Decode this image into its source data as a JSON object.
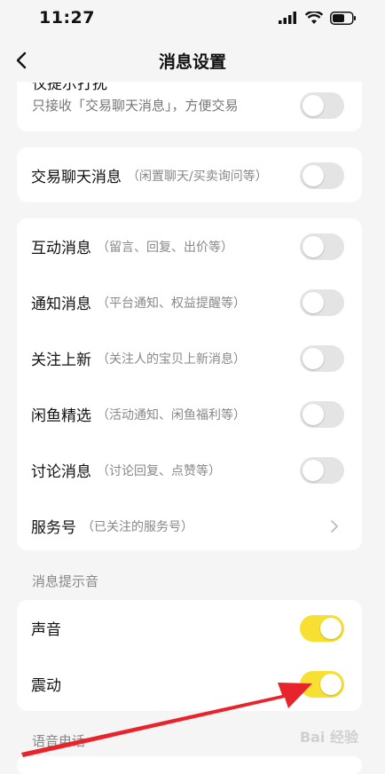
{
  "status_bar": {
    "time": "11:27"
  },
  "nav": {
    "title": "消息设置"
  },
  "top_partial": {
    "title": "仅提示打扰",
    "desc": "只接收「交易聊天消息」，方便交易",
    "toggle_on": false
  },
  "trade_card": {
    "title": "交易聊天消息",
    "desc": "（闲置聊天/买卖询问等）",
    "toggle_on": false
  },
  "message_rows": [
    {
      "title": "互动消息",
      "desc": "（留言、回复、出价等）",
      "toggle_on": false
    },
    {
      "title": "通知消息",
      "desc": "（平台通知、权益提醒等）",
      "toggle_on": false
    },
    {
      "title": "关注上新",
      "desc": "（关注人的宝贝上新消息）",
      "toggle_on": false
    },
    {
      "title": "闲鱼精选",
      "desc": "（活动通知、闲鱼福利等）",
      "toggle_on": false
    },
    {
      "title": "讨论消息",
      "desc": "（讨论回复、点赞等）",
      "toggle_on": false
    },
    {
      "title": "服务号",
      "desc": "（已关注的服务号）"
    }
  ],
  "sound_section": {
    "label": "消息提示音",
    "rows": [
      {
        "title": "声音",
        "toggle_on": true
      },
      {
        "title": "震动",
        "toggle_on": true
      }
    ]
  },
  "bottom_section_label": "语音电话",
  "watermark": "Bai 经验",
  "colors": {
    "toggle_on": "#f7e032",
    "toggle_off": "#e4e4e4",
    "arrow": "#e8232b"
  }
}
